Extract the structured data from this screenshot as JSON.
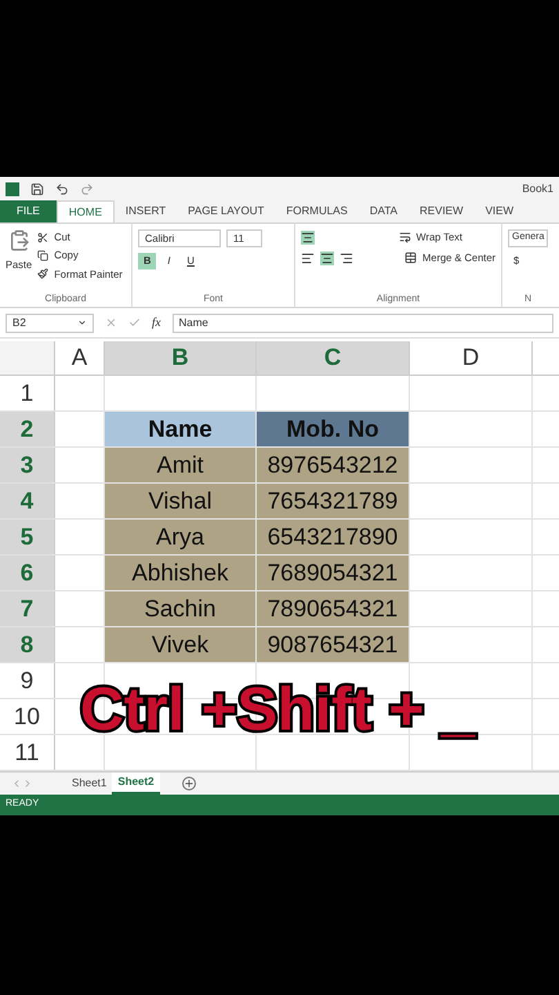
{
  "window": {
    "title": "Book1"
  },
  "ribbon_tabs": [
    {
      "label": "FILE",
      "kind": "file",
      "selected": false
    },
    {
      "label": "HOME",
      "kind": "tab",
      "selected": true
    },
    {
      "label": "INSERT",
      "kind": "tab",
      "selected": false
    },
    {
      "label": "PAGE LAYOUT",
      "kind": "tab",
      "selected": false
    },
    {
      "label": "FORMULAS",
      "kind": "tab",
      "selected": false
    },
    {
      "label": "DATA",
      "kind": "tab",
      "selected": false
    },
    {
      "label": "REVIEW",
      "kind": "tab",
      "selected": false
    },
    {
      "label": "VIEW",
      "kind": "tab",
      "selected": false
    }
  ],
  "clipboard": {
    "paste": "Paste",
    "cut": "Cut",
    "copy": "Copy",
    "format_painter": "Format Painter",
    "group": "Clipboard"
  },
  "font": {
    "name": "Calibri",
    "size": "11",
    "bold": "B",
    "italic": "I",
    "underline": "U",
    "group": "Font"
  },
  "alignment": {
    "wrap": "Wrap Text",
    "merge": "Merge & Center",
    "group": "Alignment"
  },
  "number": {
    "format": "Genera",
    "currency": "$",
    "group": "N"
  },
  "formula_bar": {
    "name_box": "B2",
    "function_label": "fx",
    "value": "Name"
  },
  "columns": [
    {
      "label": "A",
      "selected": false
    },
    {
      "label": "B",
      "selected": true
    },
    {
      "label": "C",
      "selected": true
    },
    {
      "label": "D",
      "selected": false
    }
  ],
  "rows": [
    {
      "number": "1",
      "selected": false,
      "cells": []
    },
    {
      "number": "2",
      "selected": true,
      "cells": [
        "Name",
        "Mob. No"
      ],
      "kind": "header"
    },
    {
      "number": "3",
      "selected": true,
      "cells": [
        "Amit",
        "8976543212"
      ],
      "kind": "data"
    },
    {
      "number": "4",
      "selected": true,
      "cells": [
        "Vishal",
        "7654321789"
      ],
      "kind": "data"
    },
    {
      "number": "5",
      "selected": true,
      "cells": [
        "Arya",
        "6543217890"
      ],
      "kind": "data"
    },
    {
      "number": "6",
      "selected": true,
      "cells": [
        "Abhishek",
        "7689054321"
      ],
      "kind": "data"
    },
    {
      "number": "7",
      "selected": true,
      "cells": [
        "Sachin",
        "7890654321"
      ],
      "kind": "data"
    },
    {
      "number": "8",
      "selected": true,
      "cells": [
        "Vivek",
        "9087654321"
      ],
      "kind": "data"
    },
    {
      "number": "9",
      "selected": false,
      "cells": []
    },
    {
      "number": "10",
      "selected": false,
      "cells": []
    },
    {
      "number": "11",
      "selected": false,
      "cells": []
    }
  ],
  "caption": "Ctrl +Shift + _",
  "sheets": [
    {
      "label": "Sheet1",
      "selected": false
    },
    {
      "label": "Sheet2",
      "selected": true
    }
  ],
  "status_bar": {
    "text": "READY"
  }
}
